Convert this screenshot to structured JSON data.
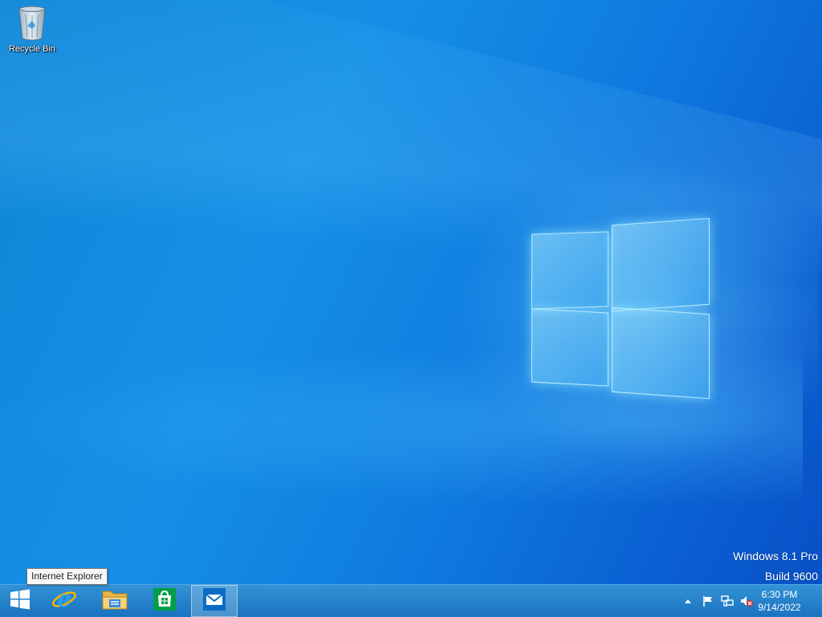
{
  "desktop": {
    "icons": [
      {
        "label": "Recycle Bin",
        "icon": "recycle-bin-icon"
      }
    ],
    "watermark": {
      "line1": "Windows 8.1 Pro",
      "line2": "Build 9600"
    }
  },
  "tooltip": {
    "text": "Internet Explorer"
  },
  "taskbar": {
    "start_icon": "windows-logo-icon",
    "pinned": [
      {
        "name": "Internet Explorer",
        "icon": "internet-explorer-icon"
      },
      {
        "name": "File Explorer",
        "icon": "file-explorer-icon"
      },
      {
        "name": "Store",
        "icon": "store-icon"
      },
      {
        "name": "Mail",
        "icon": "mail-icon",
        "active": true
      }
    ],
    "tray": {
      "icons": [
        "show-hidden-icons-chevron",
        "action-center-flag-icon",
        "network-icon",
        "volume-muted-icon"
      ],
      "time": "6:30 PM",
      "date": "9/14/2022"
    }
  },
  "colors": {
    "desktop_accent": "#1590e6",
    "taskbar": "#1f7fc8",
    "store_green": "#009e49",
    "mail_blue": "#0a6bc4"
  }
}
